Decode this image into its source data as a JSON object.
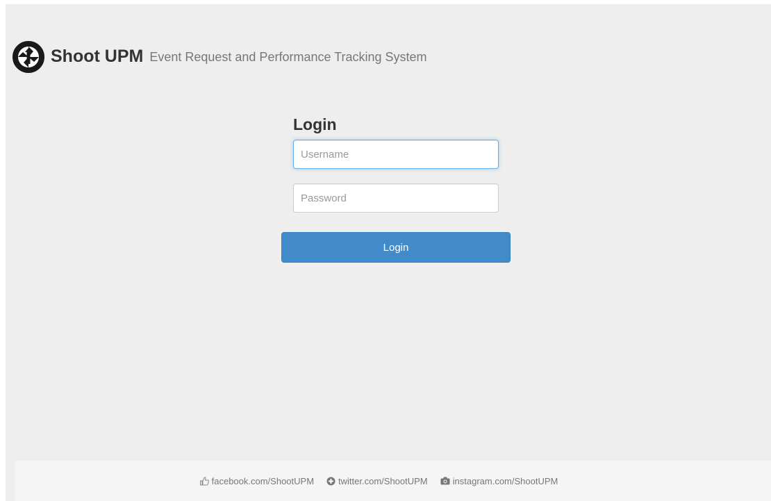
{
  "header": {
    "brand": "Shoot UPM",
    "tagline": "Event Request and Performance Tracking System",
    "logo_icon": "camera-aperture-icon"
  },
  "login": {
    "heading": "Login",
    "username": {
      "placeholder": "Username",
      "value": ""
    },
    "password": {
      "placeholder": "Password",
      "value": ""
    },
    "button_label": "Login"
  },
  "footer": {
    "links": [
      {
        "icon": "thumbs-up-icon",
        "label": "facebook.com/ShootUPM"
      },
      {
        "icon": "circle-plus-icon",
        "label": "twitter.com/ShootUPM"
      },
      {
        "icon": "camera-icon",
        "label": "instagram.com/ShootUPM"
      }
    ]
  },
  "colors": {
    "background": "#eeeeee",
    "footer_background": "#f5f5f5",
    "primary_button": "#428bca",
    "focus_border": "#66afe9",
    "brand_text": "#333333",
    "tagline_text": "#777777"
  }
}
